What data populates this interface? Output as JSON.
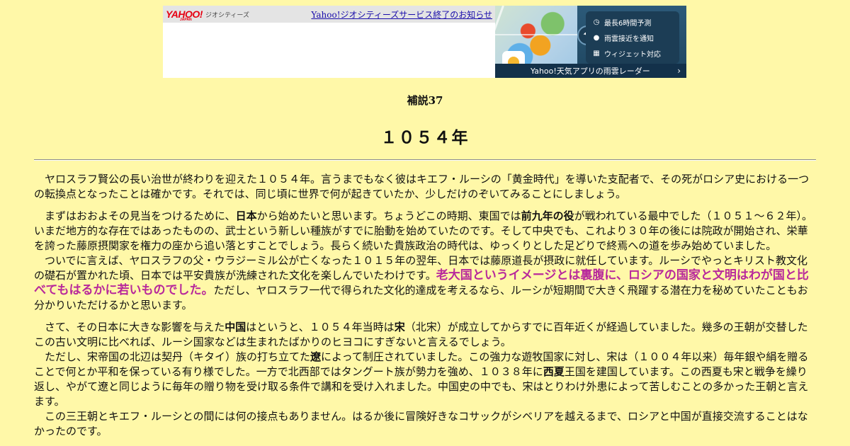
{
  "banner": {
    "logo": "YAHOO!",
    "logo_sub": "JAPAN",
    "service_name": "ジオシティーズ",
    "notice_link": "Yahoo!ジオシティーズサービス終了のお知らせ",
    "features": [
      {
        "icon": "clock-icon",
        "glyph": "◷",
        "label": "最長6時間予測"
      },
      {
        "icon": "location-pin-icon",
        "glyph": "●",
        "label": "雨雲接近を通知"
      },
      {
        "icon": "widget-grid-icon",
        "glyph": "▦",
        "label": "ウィジェット対応"
      }
    ],
    "app_label": "Yahoo!天気アプリの雨雲レーダー",
    "app_chevron": "›"
  },
  "page": {
    "subtitle": "補説37",
    "title": "１０５４年"
  },
  "article": {
    "p1": "ヤロスラフ賢公の長い治世が終わりを迎えた１０５４年。言うまでもなく彼はキエフ・ルーシの「黄金時代」を導いた支配者で、その死がロシア史における一つの転換点となったことは確かです。それでは、同じ頃に世界で何が起きていたか、少しだけのぞいてみることにしましょう。",
    "p2": {
      "t1": "まずはおおよその見当をつけるために、",
      "b1": "日本",
      "t2": "から始めたいと思います。ちょうどこの時期、東国では",
      "b2": "前九年の役",
      "t3": "が戦われている最中でした（１０５１～６２年）。いまだ地方的な存在ではあったものの、武士という新しい種族がすでに胎動を始めていたのです。そして中央でも、これより３０年の後には院政が開始され、栄華を誇った藤原摂関家を権力の座から追い落とすことでしょう。長らく続いた貴族政治の時代は、ゆっくりとした足どりで終焉への道を歩み始めていました。"
    },
    "p3": {
      "t1": "ついでに言えば、ヤロスラフの父・ウラジーミル公が亡くなった１０１５年の翌年、日本では藤原道長が摂政に就任しています。ルーシでやっとキリスト教文化の礎石が置かれた頃、日本では平安貴族が洗練された文化を楽しんでいたわけです。",
      "hl": "老大国というイメージとは裏腹に、ロシアの国家と文明はわが国と比べてもはるかに若いものでした。",
      "t2": "ただし、ヤロスラフ一代で得られた文化的達成を考えるなら、ルーシが短期間で大きく飛躍する潜在力を秘めていたこともお分かりいただけるかと思います。"
    },
    "p4": {
      "t1": "さて、その日本に大きな影響を与えた",
      "b1": "中国",
      "t2": "はというと、１０５４年当時は",
      "b2": "宋",
      "t3": "（北宋）が成立してからすでに百年近くが経過していました。幾多の王朝が交替したこの古い文明に比べれば、ルーシ国家などは生まれたばかりのヒヨコにすぎないと言えるでしょう。"
    },
    "p5": {
      "t1": "ただし、宋帝国の北辺は契丹（キタイ）族の打ち立てた",
      "b1": "遼",
      "t2": "によって制圧されていました。この強力な遊牧国家に対し、宋は（１００４年以来）毎年銀や絹を贈ることで何とか平和を保っている有り様でした。一方で北西部ではタングート族が勢力を強め、１０３８年に",
      "b2": "西夏",
      "t3": "王国を建国しています。この西夏も宋と戦争を繰り返し、やがて遼と同じように毎年の贈り物を受け取る条件で講和を受け入れました。中国史の中でも、宋はとりわけ外患によって苦しむことの多かった王朝と言えます。"
    },
    "p6": "この三王朝とキエフ・ルーシとの間には何の接点もありません。はるか後に冒険好きなコサックがシベリアを越えるまで、ロシアと中国が直接交流することはなかったのです。"
  },
  "colors": {
    "background": "#fff8a8",
    "highlight": "#b8299b",
    "link": "#1a0dab"
  }
}
